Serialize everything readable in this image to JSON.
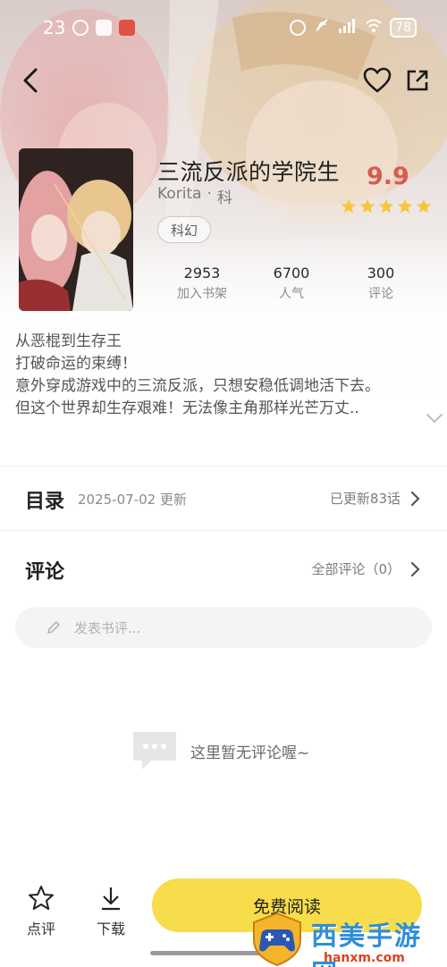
{
  "status_bar": {
    "time": "23",
    "battery": "78"
  },
  "book": {
    "title": "三流反派的学院生",
    "author": "Korita",
    "separator": "·",
    "category_short": "科",
    "genre_tag": "科幻",
    "rating": "9.9",
    "star_count": 5,
    "star_color": "#f5c63a"
  },
  "stats": [
    {
      "value": "2953",
      "label": "加入书架"
    },
    {
      "value": "6700",
      "label": "人气"
    },
    {
      "value": "300",
      "label": "评论"
    }
  ],
  "synopsis": {
    "lines": [
      "从恶棍到生存王",
      "打破命运的束缚！",
      "意外穿成游戏中的三流反派，只想安稳低调地活下去。",
      "但这个世界却生存艰难！无法像主角那样光芒万丈.."
    ]
  },
  "toc": {
    "heading": "目录",
    "updated_date": "2025-07-02 更新",
    "updated_count": "已更新83话"
  },
  "comments": {
    "heading": "评论",
    "all_label": "全部评论（0）",
    "input_placeholder": "发表书评...",
    "empty_text": "这里暂无评论喔~"
  },
  "bottom_bar": {
    "rate_label": "点评",
    "download_label": "下载",
    "read_label": "免费阅读",
    "accent_color": "#f7dc4b"
  },
  "watermark": {
    "text": "西美手游网",
    "url": "hanxm.com"
  },
  "icons": {
    "back": "chevron-left-icon",
    "favorite": "heart-icon",
    "share": "share-icon",
    "expand": "chevron-down-icon",
    "edit": "pencil-icon",
    "empty": "chat-bubble-icon",
    "rate": "star-outline-icon",
    "download": "download-icon"
  }
}
